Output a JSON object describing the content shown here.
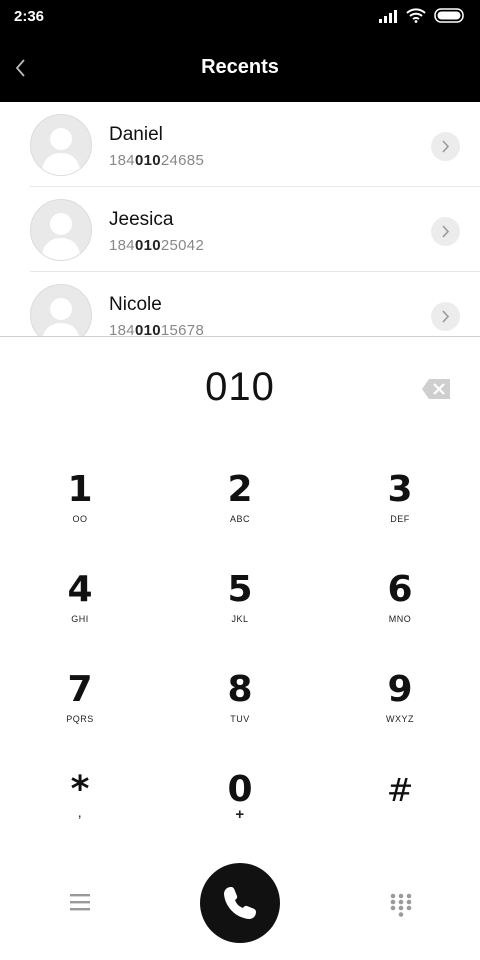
{
  "status_bar": {
    "time": "2:36"
  },
  "header": {
    "title": "Recents"
  },
  "recents": [
    {
      "name": "Daniel",
      "number_prefix": "184",
      "number_match": "010",
      "number_suffix": "24685"
    },
    {
      "name": "Jeesica",
      "number_prefix": "184",
      "number_match": "010",
      "number_suffix": "25042"
    },
    {
      "name": "Nicole",
      "number_prefix": "184",
      "number_match": "010",
      "number_suffix": "15678"
    }
  ],
  "dialer": {
    "input": "010"
  },
  "keypad": [
    {
      "digit": "1",
      "letters": "OO"
    },
    {
      "digit": "2",
      "letters": "ABC"
    },
    {
      "digit": "3",
      "letters": "DEF"
    },
    {
      "digit": "4",
      "letters": "GHI"
    },
    {
      "digit": "5",
      "letters": "JKL"
    },
    {
      "digit": "6",
      "letters": "MNO"
    },
    {
      "digit": "7",
      "letters": "PQRS"
    },
    {
      "digit": "8",
      "letters": "TUV"
    },
    {
      "digit": "9",
      "letters": "WXYZ"
    },
    {
      "digit": "*",
      "letters": ","
    },
    {
      "digit": "0",
      "letters": "+"
    },
    {
      "digit": "#",
      "letters": ""
    }
  ],
  "colors": {
    "bar": "#000000",
    "accent": "#111111",
    "muted": "#888888"
  }
}
